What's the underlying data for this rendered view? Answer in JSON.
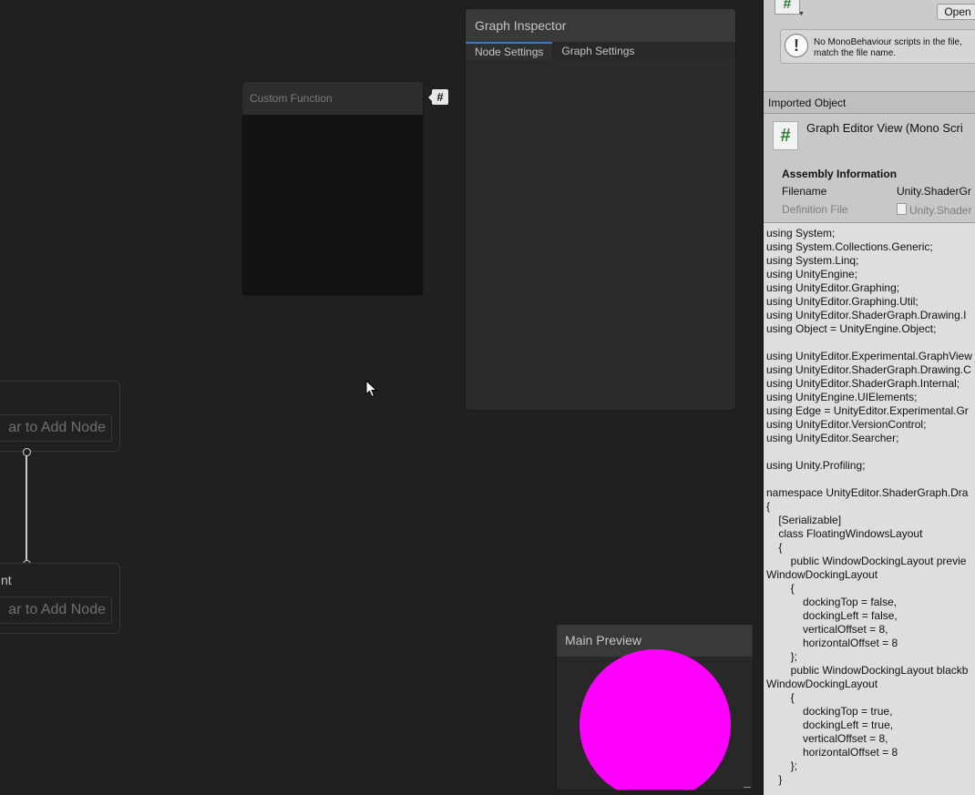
{
  "graph_inspector": {
    "title": "Graph Inspector",
    "tabs": [
      {
        "label": "Node Settings",
        "active": true
      },
      {
        "label": "Graph Settings",
        "active": false
      }
    ]
  },
  "custom_function_node": {
    "title": "Custom Function",
    "badge": "#"
  },
  "stacks": [
    {
      "label": "",
      "add_node_text": "ar to Add Node"
    },
    {
      "label": "nt",
      "add_node_text": "ar to Add Node"
    }
  ],
  "main_preview": {
    "title": "Main Preview",
    "sphere_color": "#ff00ff"
  },
  "inspector": {
    "script_icon": "#",
    "open_button": "Open",
    "help_message_line1": "No MonoBehaviour scripts in the file,",
    "help_message_line2": "match the file name.",
    "imported_object_header": "Imported Object",
    "object_icon": "#",
    "object_title": "Graph Editor View (Mono Scri",
    "assembly": {
      "heading": "Assembly Information",
      "filename_label": "Filename",
      "filename_value": "Unity.ShaderGr",
      "definition_label": "Definition File",
      "definition_value": "Unity.Shader"
    },
    "code_lines": [
      "using System;",
      "using System.Collections.Generic;",
      "using System.Linq;",
      "using UnityEngine;",
      "using UnityEditor.Graphing;",
      "using UnityEditor.Graphing.Util;",
      "using UnityEditor.ShaderGraph.Drawing.I",
      "using Object = UnityEngine.Object;",
      "",
      "using UnityEditor.Experimental.GraphView",
      "using UnityEditor.ShaderGraph.Drawing.C",
      "using UnityEditor.ShaderGraph.Internal;",
      "using UnityEngine.UIElements;",
      "using Edge = UnityEditor.Experimental.Gr",
      "using UnityEditor.VersionControl;",
      "using UnityEditor.Searcher;",
      "",
      "using Unity.Profiling;",
      "",
      "namespace UnityEditor.ShaderGraph.Dra",
      "{",
      "    [Serializable]",
      "    class FloatingWindowsLayout",
      "    {",
      "        public WindowDockingLayout previe",
      "WindowDockingLayout",
      "        {",
      "            dockingTop = false,",
      "            dockingLeft = false,",
      "            verticalOffset = 8,",
      "            horizontalOffset = 8",
      "        };",
      "        public WindowDockingLayout blackb",
      "WindowDockingLayout",
      "        {",
      "            dockingTop = true,",
      "            dockingLeft = true,",
      "            verticalOffset = 8,",
      "            horizontalOffset = 8",
      "        };",
      "    }"
    ]
  }
}
